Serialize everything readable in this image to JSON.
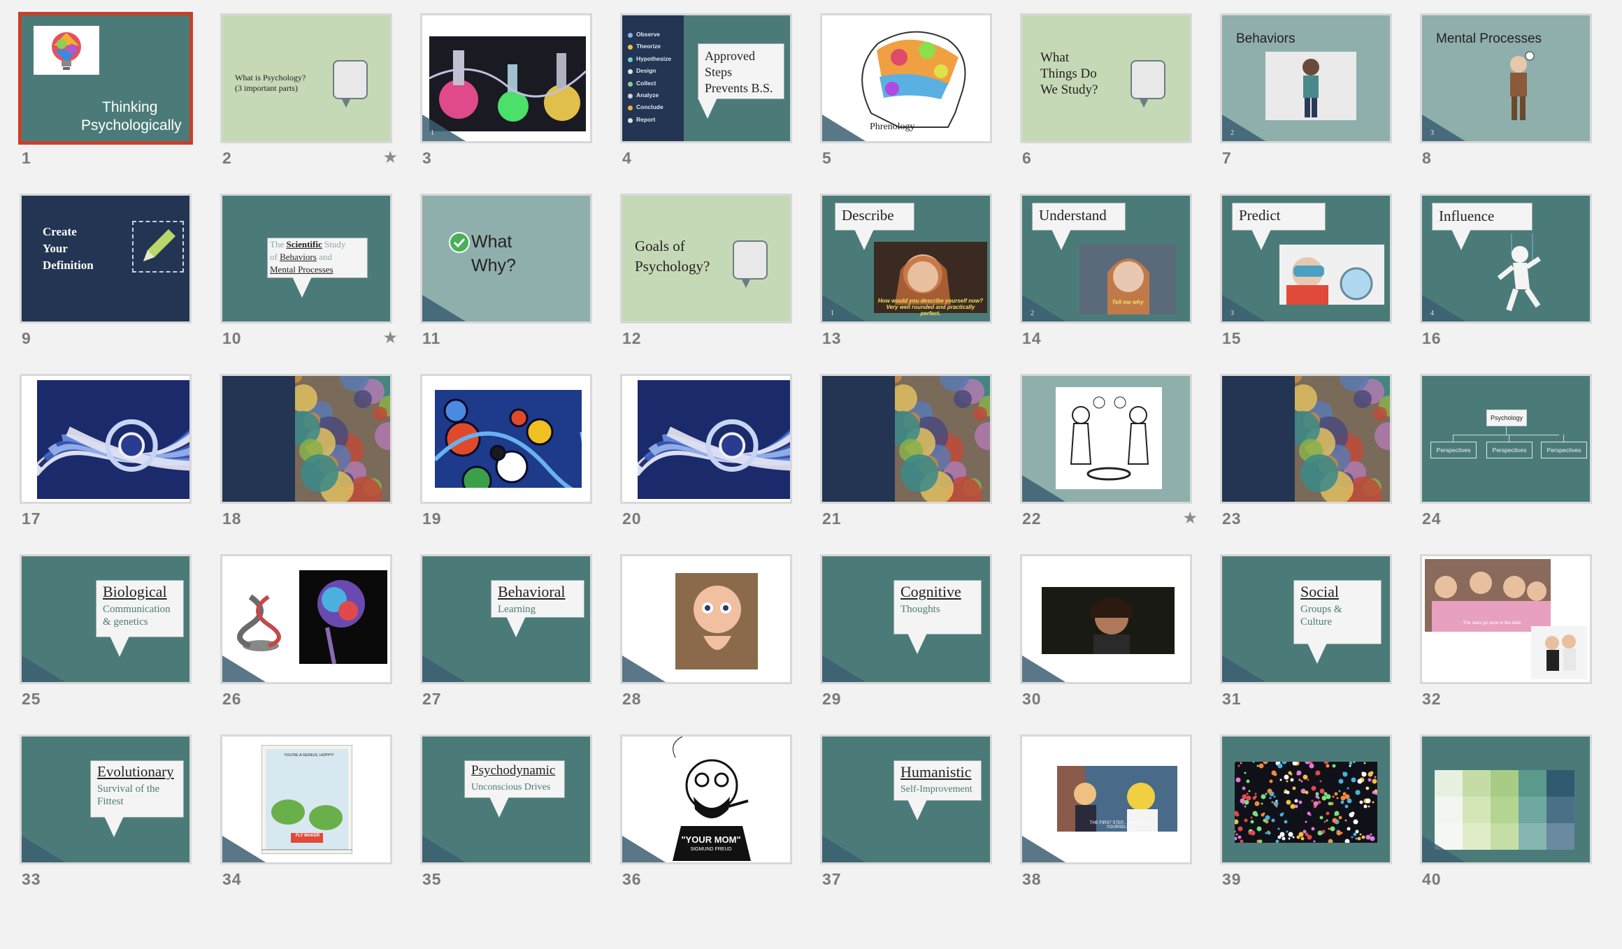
{
  "slides": [
    {
      "num": "1",
      "bg": "teal",
      "title_lines": [
        "Thinking",
        "Psychologically"
      ],
      "selected": true
    },
    {
      "num": "2",
      "bg": "green",
      "text_lines": [
        "What is Psychology?",
        "(3 important parts)"
      ],
      "starred": true
    },
    {
      "num": "3",
      "bg": "white",
      "image": "lab-glassware",
      "cnum": "1"
    },
    {
      "num": "4",
      "bg": "teal",
      "steps": [
        "Observe",
        "Theorize",
        "Hypothesize",
        "Design",
        "Collect",
        "Analyze",
        "Conclude",
        "Report"
      ],
      "callout_lines": [
        "Approved",
        "Steps",
        "Prevents B.S."
      ]
    },
    {
      "num": "5",
      "bg": "white",
      "image": "phrenology-head",
      "caption": "Phrenology"
    },
    {
      "num": "6",
      "bg": "green",
      "text_lines": [
        "What",
        "Things Do",
        "We Study?"
      ]
    },
    {
      "num": "7",
      "bg": "blue",
      "title": "Behaviors",
      "image": "standing-man",
      "cnum": "2"
    },
    {
      "num": "8",
      "bg": "blue",
      "title": "Mental Processes",
      "image": "thinking-figure",
      "cnum": "3"
    },
    {
      "num": "9",
      "bg": "navy",
      "text_lines": [
        "Create",
        "Your",
        "Definition"
      ],
      "image": "pencil-icon"
    },
    {
      "num": "10",
      "bg": "teal",
      "definition": {
        "w1": "The ",
        "w2": "Scientific",
        "w3": " Study",
        "w4": "of ",
        "w5": "Behaviors",
        "w6": " and",
        "w7": "Mental Processes"
      },
      "starred": true
    },
    {
      "num": "11",
      "bg": "blue",
      "text_lines": [
        "What",
        "Why?"
      ],
      "image": "check-icon"
    },
    {
      "num": "12",
      "bg": "green",
      "text_lines": [
        "Goals of",
        "Psychology?"
      ]
    },
    {
      "num": "13",
      "bg": "teal",
      "callout": "Describe",
      "image": "gif-describe",
      "gif_caption": "How would you describe yourself now? Very well rounded and practically perfect.",
      "cnum": "1"
    },
    {
      "num": "14",
      "bg": "teal",
      "callout": "Understand",
      "image": "gif-understand",
      "gif_caption": "Tell me why",
      "cnum": "2"
    },
    {
      "num": "15",
      "bg": "teal",
      "callout": "Predict",
      "image": "gif-predict",
      "cnum": "3"
    },
    {
      "num": "16",
      "bg": "teal",
      "callout": "Influence",
      "image": "puppet-figure",
      "cnum": "4"
    },
    {
      "num": "17",
      "bg": "white",
      "image": "swirl-painting"
    },
    {
      "num": "18",
      "bg": "navy",
      "image": "collage-painting"
    },
    {
      "num": "19",
      "bg": "white",
      "image": "abstract-painting"
    },
    {
      "num": "20",
      "bg": "white",
      "image": "swirl-painting"
    },
    {
      "num": "21",
      "bg": "navy",
      "image": "collage-painting"
    },
    {
      "num": "22",
      "bg": "blue",
      "image": "cartoon-men",
      "starred": true
    },
    {
      "num": "23",
      "bg": "navy",
      "image": "collage-painting"
    },
    {
      "num": "24",
      "bg": "teal",
      "chart": {
        "root": "Psychology",
        "children": [
          "Perspectives",
          "Perspectives",
          "Perspectives"
        ]
      }
    },
    {
      "num": "25",
      "bg": "teal",
      "callout_title": "Biological",
      "callout_sub": [
        "Communication",
        "& genetics"
      ]
    },
    {
      "num": "26",
      "bg": "white",
      "image": "dna-brain"
    },
    {
      "num": "27",
      "bg": "teal",
      "callout_title": "Behavioral",
      "callout_sub": [
        "Learning"
      ]
    },
    {
      "num": "28",
      "bg": "white",
      "image": "baby-cartoon"
    },
    {
      "num": "29",
      "bg": "teal",
      "callout_title": "Cognitive",
      "callout_sub": [
        "Thoughts"
      ]
    },
    {
      "num": "30",
      "bg": "white",
      "image": "movie-still"
    },
    {
      "num": "31",
      "bg": "teal",
      "callout_title": "Social",
      "callout_sub": [
        "Groups &",
        "Culture"
      ]
    },
    {
      "num": "32",
      "bg": "white",
      "image": "musical-group",
      "gif_caption": "The stars go pure in the dark"
    },
    {
      "num": "33",
      "bg": "teal",
      "callout_title": "Evolutionary",
      "callout_sub": [
        "Survival of the",
        "Fittest"
      ]
    },
    {
      "num": "34",
      "bg": "white",
      "image": "frog-comic",
      "comic_caption": "YOU'RE A GENIUS, HOPPY!",
      "comic_sign": "FLY MAKER"
    },
    {
      "num": "35",
      "bg": "teal",
      "callout_title": "Psychodynamic",
      "callout_sub": [
        "Unconscious Drives"
      ]
    },
    {
      "num": "36",
      "bg": "white",
      "image": "freud-cartoon",
      "caption": "\"YOUR MOM\"",
      "caption2": "SIGMUND FREUD"
    },
    {
      "num": "37",
      "bg": "teal",
      "callout_title": "Humanistic",
      "callout_sub": [
        "Self-Improvement"
      ]
    },
    {
      "num": "38",
      "bg": "white",
      "image": "simpsons-still",
      "gif_caption": "THE FIRST STEP... HIMSELF... YOURSELF..."
    },
    {
      "num": "39",
      "bg": "teal",
      "image": "confetti-dots"
    },
    {
      "num": "40",
      "bg": "teal",
      "palette": {
        "colors": [
          "#e8f0e0",
          "#c6dca6",
          "#a8cc86",
          "#5a9a8c",
          "#2f5a70",
          "#f2f5f0",
          "#d4e6b8",
          "#b4d492",
          "#6ea8a0",
          "#4a7088",
          "#f6f8f4",
          "#e0ecc8",
          "#c4dea6",
          "#86b6b0",
          "#6a8aa0"
        ]
      }
    }
  ]
}
